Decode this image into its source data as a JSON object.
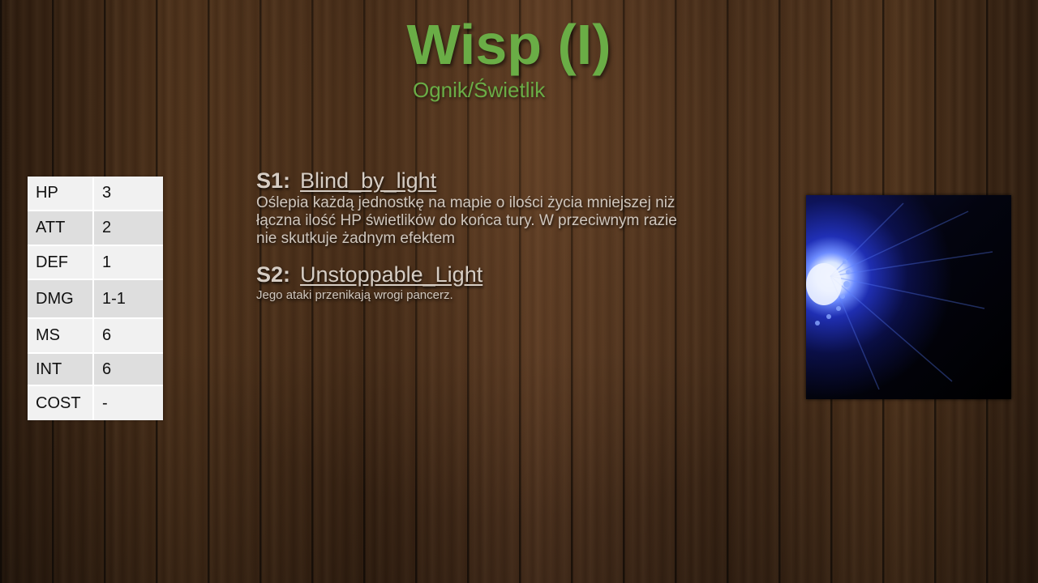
{
  "title": "Wisp (I)",
  "subtitle": "Ognik/Świetlik",
  "stats": [
    {
      "label": "HP",
      "value": "3"
    },
    {
      "label": "ATT",
      "value": "2"
    },
    {
      "label": "DEF",
      "value": "1"
    },
    {
      "label": "DMG",
      "value": "1-1"
    },
    {
      "label": "MS",
      "value": "6"
    },
    {
      "label": "INT",
      "value": "6"
    },
    {
      "label": "COST",
      "value": "-"
    }
  ],
  "skills": [
    {
      "key": "S1:",
      "name": "Blind_by_light",
      "description": "Oślepia każdą jednostkę na mapie o ilości życia mniejszej niż łączna ilość HP świetlików  do końca tury. W przeciwnym razie nie skutkuje żadnym efektem"
    },
    {
      "key": "S2:",
      "name": "Unstoppable_Light",
      "description": "Jego ataki przenikają wrogi pancerz."
    }
  ],
  "image": {
    "icon": "blue-wisp-light-image"
  }
}
